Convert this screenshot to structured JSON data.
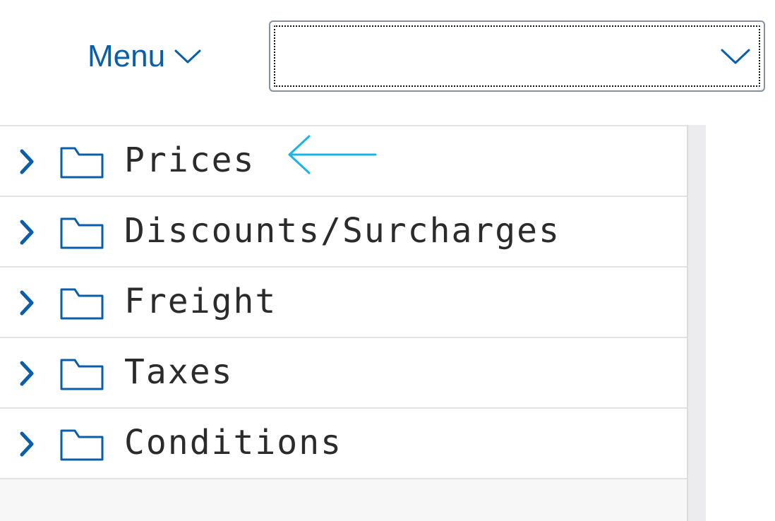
{
  "header": {
    "menu_label": "Menu",
    "select_value": ""
  },
  "tree": {
    "items": [
      {
        "label": "Prices"
      },
      {
        "label": "Discounts/Surcharges"
      },
      {
        "label": "Freight"
      },
      {
        "label": "Taxes"
      },
      {
        "label": "Conditions"
      }
    ]
  },
  "icons": {
    "menu_chevron": "chevron-down-icon",
    "select_chevron": "chevron-down-icon",
    "expander": "chevron-right-icon",
    "folder": "folder-icon",
    "annotation": "arrow-left-icon"
  },
  "colors": {
    "accent": "#0a5fa8",
    "annotation": "#19b5e6",
    "text": "#2b2b2b"
  }
}
